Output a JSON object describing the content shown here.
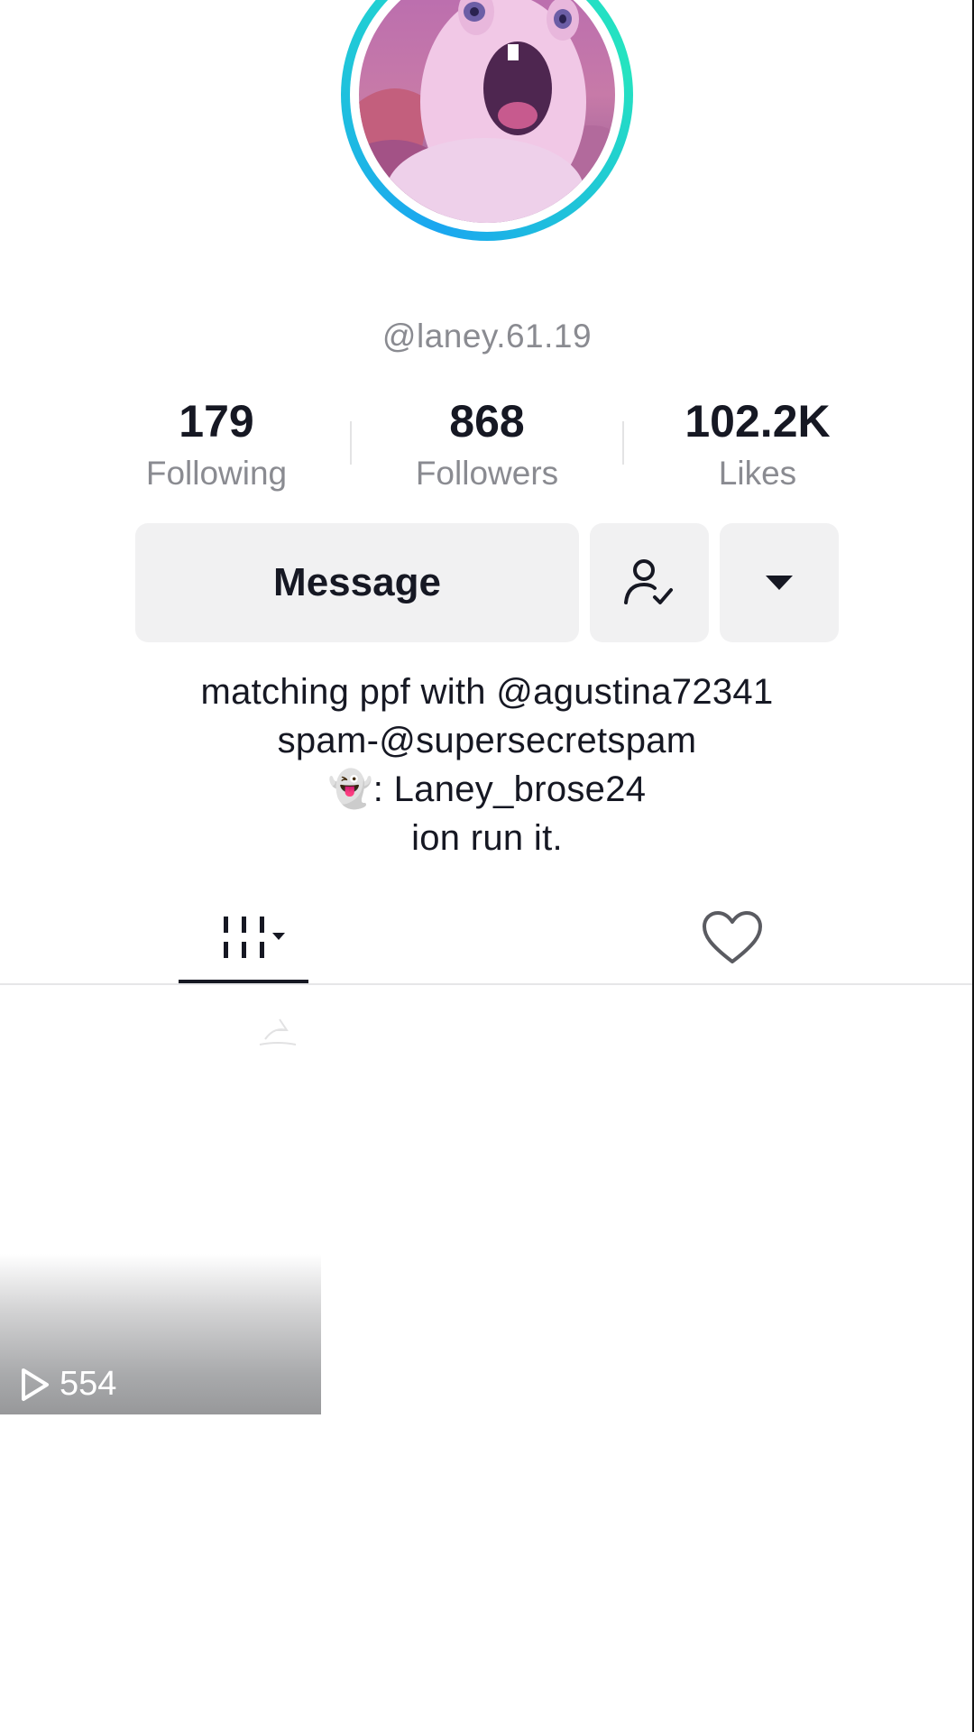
{
  "profile": {
    "username": "@laney.61.19",
    "avatar_icon": "profile-photo-rabbid-character"
  },
  "stats": [
    {
      "value": "179",
      "label": "Following"
    },
    {
      "value": "868",
      "label": "Followers"
    },
    {
      "value": "102.2K",
      "label": "Likes"
    }
  ],
  "actions": {
    "message_label": "Message",
    "following_icon": "user-check-icon",
    "more_icon": "caret-down-icon"
  },
  "bio": {
    "lines": [
      "matching ppf with @agustina72341",
      "spam-@supersecretspam",
      "👻: Laney_brose24",
      "ion run it."
    ]
  },
  "tabs": [
    {
      "name": "videos",
      "icon": "grid-icon",
      "selected": true
    },
    {
      "name": "liked",
      "icon": "heart-outline-icon",
      "selected": false
    }
  ],
  "videos": [
    {
      "views": "554",
      "icon": "play-icon"
    }
  ],
  "colors": {
    "ring_start": "#1aa6f0",
    "ring_end": "#25e3c0",
    "text_primary": "#161823",
    "text_secondary": "#8a8b91",
    "button_bg": "#f1f1f2"
  }
}
